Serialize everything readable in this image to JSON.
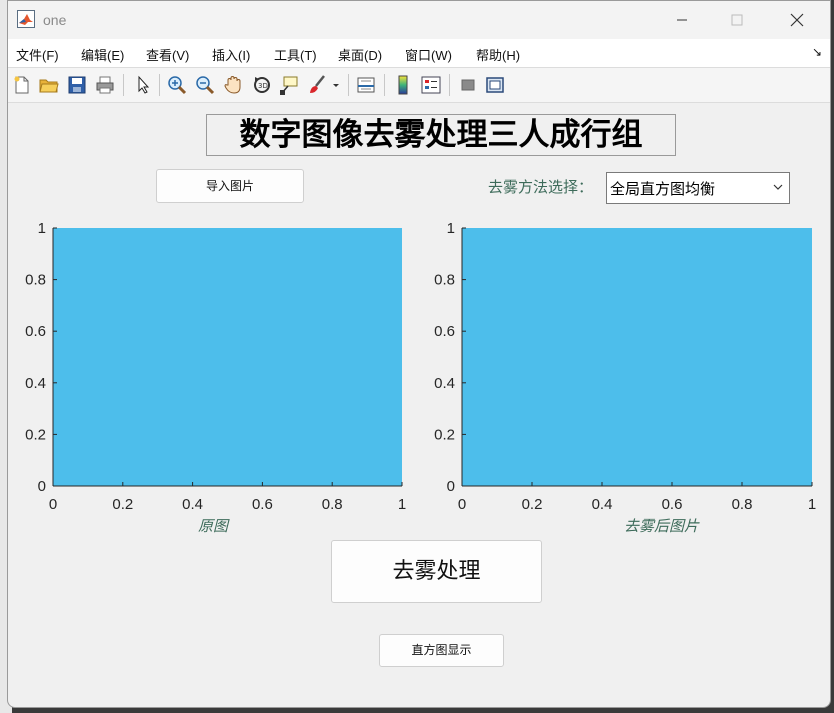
{
  "window": {
    "title": "one"
  },
  "menu": [
    "文件(F)",
    "编辑(E)",
    "查看(V)",
    "插入(I)",
    "工具(T)",
    "桌面(D)",
    "窗口(W)",
    "帮助(H)"
  ],
  "toolbar_icons": [
    "new-file-icon",
    "open-folder-icon",
    "save-icon",
    "print-icon",
    "pointer-icon",
    "zoom-in-icon",
    "zoom-out-icon",
    "pan-hand-icon",
    "rotate-3d-icon",
    "data-tips-icon",
    "brush-icon",
    "brush-dropdown-icon",
    "link-plot-icon",
    "colorbar-icon",
    "legend-icon",
    "hide-plot-tools-icon",
    "show-plot-tools-icon"
  ],
  "app": {
    "title": "数字图像去雾处理三人成行组",
    "import_button": "导入图片",
    "method_label": "去雾方法选择：",
    "method_value": "全局直方图均衡",
    "process_button": "去雾处理",
    "histogram_button": "直方图显示"
  },
  "axes": [
    {
      "caption": "原图",
      "xticks": [
        "0",
        "0.2",
        "0.4",
        "0.6",
        "0.8",
        "1"
      ],
      "yticks": [
        "0",
        "0.2",
        "0.4",
        "0.6",
        "0.8",
        "1"
      ],
      "xlim": [
        0,
        1
      ],
      "ylim": [
        0,
        1
      ],
      "fill": "#4dbeeb"
    },
    {
      "caption": "去雾后图片",
      "xticks": [
        "0",
        "0.2",
        "0.4",
        "0.6",
        "0.8",
        "1"
      ],
      "yticks": [
        "0",
        "0.2",
        "0.4",
        "0.6",
        "0.8",
        "1"
      ],
      "xlim": [
        0,
        1
      ],
      "ylim": [
        0,
        1
      ],
      "fill": "#4dbeeb"
    }
  ]
}
